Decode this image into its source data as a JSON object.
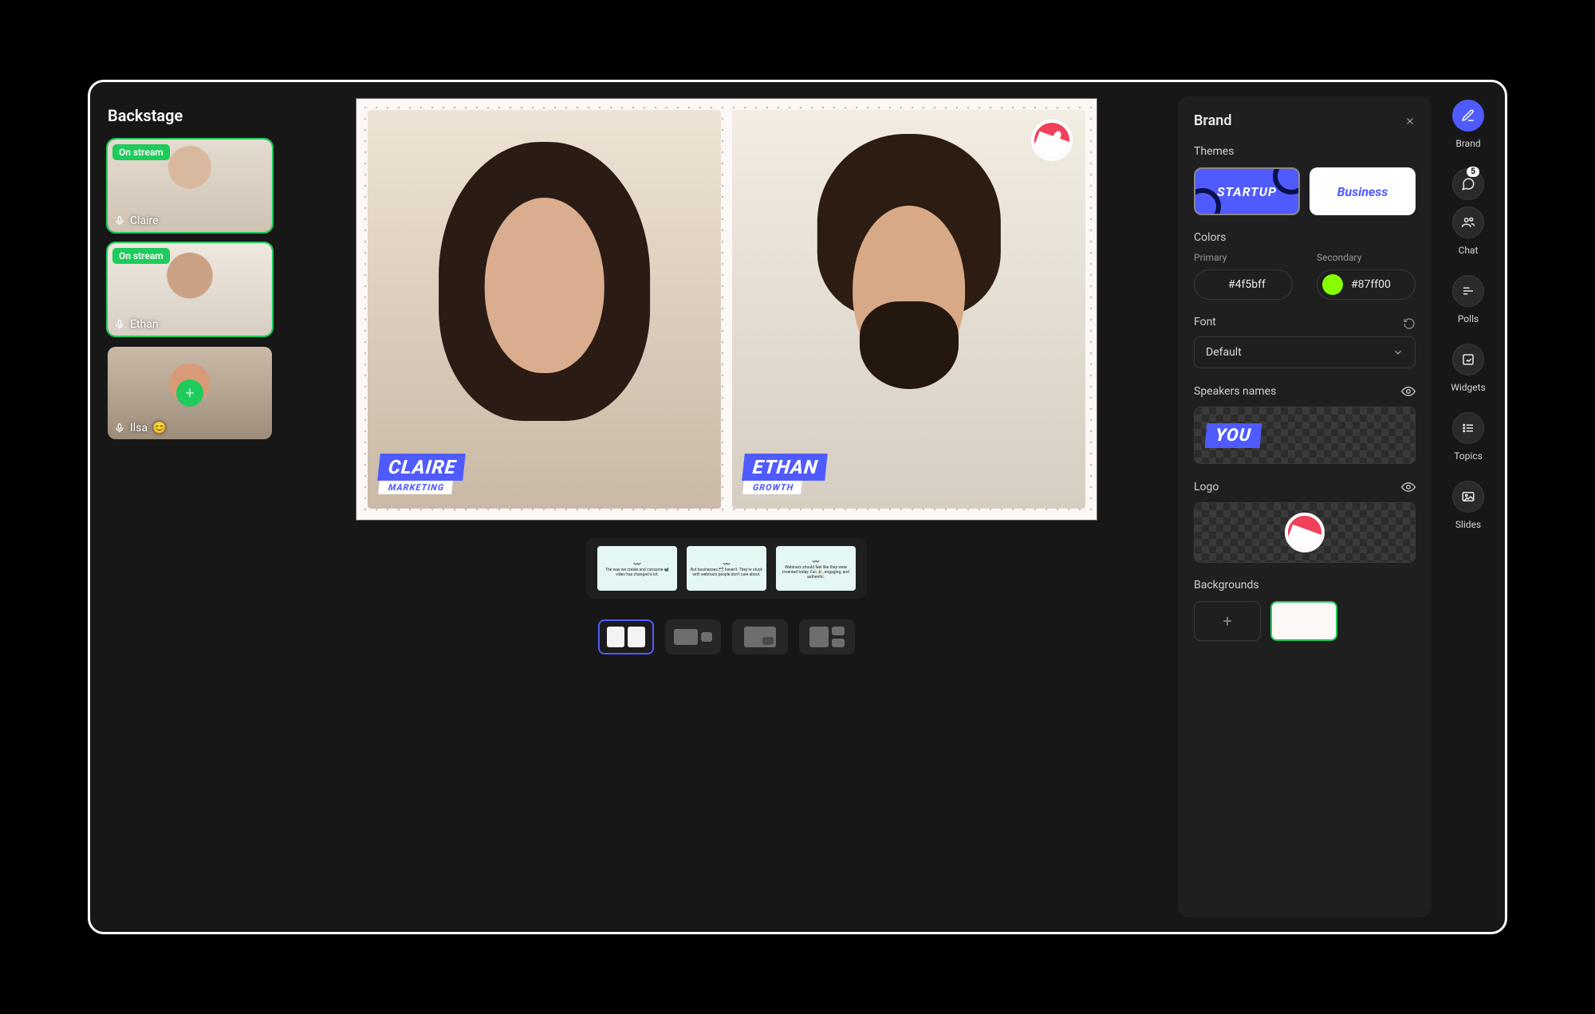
{
  "backstage": {
    "title": "Backstage",
    "on_stream_label": "On stream",
    "participants": [
      {
        "name": "Claire",
        "on_stream": true,
        "status_emoji": ""
      },
      {
        "name": "Ethan",
        "on_stream": true,
        "status_emoji": ""
      },
      {
        "name": "Ilsa",
        "on_stream": false,
        "status_emoji": "😊"
      }
    ]
  },
  "stage": {
    "speakers": [
      {
        "name": "CLAIRE",
        "role": "MARKETING"
      },
      {
        "name": "ETHAN",
        "role": "GROWTH"
      }
    ],
    "logo_name": "watermelon-logo",
    "slides": [
      "The way we create and consume 📹 video has changed a lot.",
      "But businesses 🗂 haven't. They're stuck with webinars people don't care about.",
      "Webinars should feel like they were invented today. Fun 🎉, engaging, and authentic."
    ],
    "layouts": [
      "split-2",
      "pip-small",
      "pip-corner",
      "grid-3"
    ],
    "active_layout": "split-2"
  },
  "brand_panel": {
    "title": "Brand",
    "sections": {
      "themes": "Themes",
      "colors": "Colors",
      "primary": "Primary",
      "secondary": "Secondary",
      "font": "Font",
      "speakers_names": "Speakers names",
      "logo": "Logo",
      "backgrounds": "Backgrounds"
    },
    "themes": [
      {
        "id": "startup",
        "label": "STARTUP",
        "selected": true
      },
      {
        "id": "business",
        "label": "Business",
        "selected": false
      }
    ],
    "colors": {
      "primary": "#4f5bff",
      "secondary": "#87ff00"
    },
    "font": {
      "value": "Default"
    },
    "speakers_preview": "YOU",
    "backgrounds": {
      "selected_color": "#fdf8f5"
    }
  },
  "rail": {
    "items": [
      {
        "id": "brand",
        "label": "Brand",
        "active": true
      },
      {
        "id": "chat",
        "label": "Chat",
        "badge": "5"
      },
      {
        "id": "polls",
        "label": "Polls"
      },
      {
        "id": "widgets",
        "label": "Widgets"
      },
      {
        "id": "topics",
        "label": "Topics"
      },
      {
        "id": "slides",
        "label": "Slides"
      }
    ]
  }
}
